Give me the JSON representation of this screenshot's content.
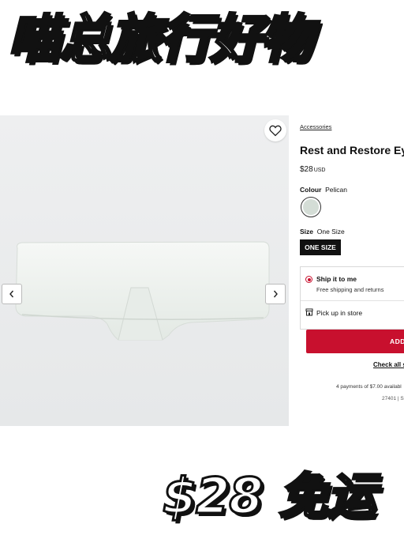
{
  "poster": {
    "headline": "喵总旅行好物",
    "footer": "$28 免运"
  },
  "product": {
    "breadcrumb": "Accessories",
    "title": "Rest and Restore Ey",
    "price": "$28",
    "currency": "USD",
    "colour_label": "Colour",
    "colour_value": "Pelican",
    "swatch_color": "#d4ddd6",
    "size_label": "Size",
    "size_value": "One Size",
    "size_option": "ONE SIZE"
  },
  "fulfillment": {
    "ship_title": "Ship it to me",
    "ship_sub": "Free shipping and returns",
    "pickup_label": "Pick up in store"
  },
  "actions": {
    "add_label": "ADD",
    "check_all": "Check all s"
  },
  "footer": {
    "payments": "4 payments of $7.00 availabl",
    "store_code": "27401 | S"
  },
  "colors": {
    "accent": "#c8102e",
    "dark": "#111111"
  },
  "icons": {
    "favorite": "heart-icon",
    "prev": "chevron-left-icon",
    "next": "chevron-right-icon",
    "store": "store-icon"
  }
}
